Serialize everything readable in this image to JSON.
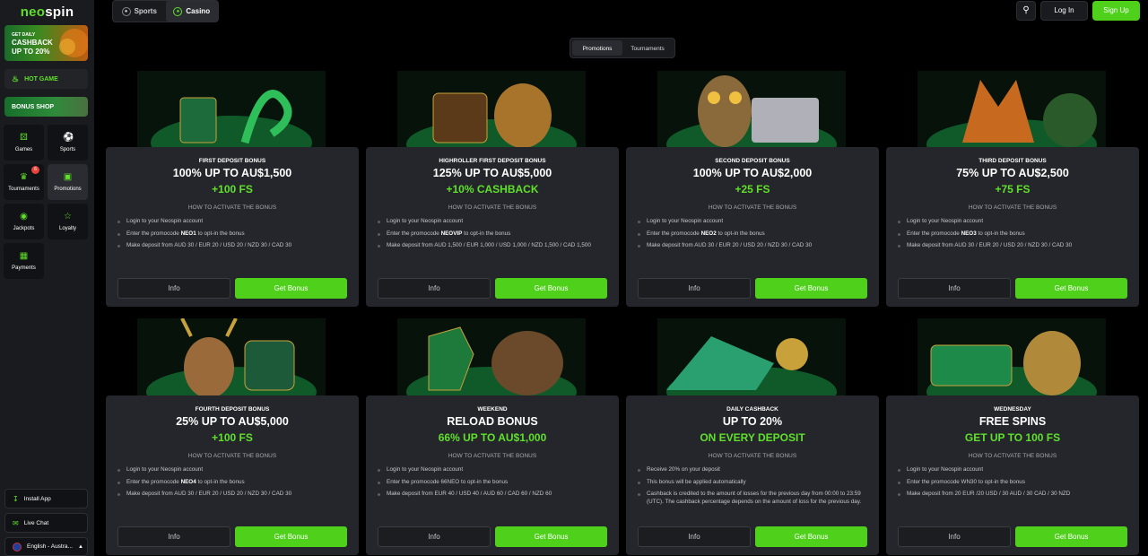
{
  "brand": {
    "part1": "neo",
    "part2": "spin"
  },
  "sidebar": {
    "banner": {
      "l1": "GET DAILY",
      "l2": "CASHBACK",
      "l3": "UP TO 20%"
    },
    "hot_game": "HOT GAME",
    "bonus_shop": "BONUS SHOP",
    "tiles": [
      {
        "label": "Games",
        "icon": "dice-icon"
      },
      {
        "label": "Sports",
        "icon": "soccer-ball-icon"
      },
      {
        "label": "Tournaments",
        "icon": "trophy-icon",
        "badge": "6"
      },
      {
        "label": "Promotions",
        "icon": "gift-icon"
      },
      {
        "label": "Jackpots",
        "icon": "money-bag-icon"
      },
      {
        "label": "Loyalty",
        "icon": "star-icon"
      },
      {
        "label": "Payments",
        "icon": "cash-icon"
      }
    ],
    "install_app": "Install App",
    "live_chat": "Live Chat",
    "language": "English - Austra..."
  },
  "topbar": {
    "sports": "Sports",
    "casino": "Casino",
    "login": "Log In",
    "signup": "Sign Up"
  },
  "subtabs": {
    "promotions": "Promotions",
    "tournaments": "Tournaments"
  },
  "colors": {
    "accent": "#4fd01a",
    "bonus_text": "#5fe02a",
    "card": "#25262b",
    "sidebar": "#1a1b1f"
  },
  "how_label": "HOW TO ACTIVATE THE BONUS",
  "info_label": "Info",
  "get_label": "Get Bonus",
  "cards": [
    {
      "kicker": "FIRST DEPOSIT BONUS",
      "head": "100% UP TO AU$1,500",
      "bonus": "+100 FS",
      "items": [
        [
          "Login to your Neospin account",
          "",
          ""
        ],
        [
          "Enter the promocode ",
          "NEO1",
          " to opt-in the bonus"
        ],
        [
          "Make deposit from AUD 30 / EUR 20 / USD 20 / NZD 30 / CAD 30",
          "",
          ""
        ]
      ]
    },
    {
      "kicker": "HIGHROLLER FIRST DEPOSIT BONUS",
      "head": "125% UP TO AU$5,000",
      "bonus": "+10% CASHBACK",
      "items": [
        [
          "Login to your Neospin account",
          "",
          ""
        ],
        [
          "Enter the promocode ",
          "NEOVIP",
          " to opt-in the bonus"
        ],
        [
          "Make deposit from AUD 1,500 / EUR 1,000 / USD 1,000 / NZD 1,500 / CAD 1,500",
          "",
          ""
        ]
      ]
    },
    {
      "kicker": "SECOND DEPOSIT BONUS",
      "head": "100% UP TO AU$2,000",
      "bonus": "+25 FS",
      "items": [
        [
          "Login to your Neospin account",
          "",
          ""
        ],
        [
          "Enter the promocode ",
          "NEO2",
          " to opt-in the bonus"
        ],
        [
          "Make deposit from AUD 30 / EUR 20 / USD 20 / NZD 30 / CAD 30",
          "",
          ""
        ]
      ]
    },
    {
      "kicker": "THIRD DEPOSIT BONUS",
      "head": "75% UP TO AU$2,500",
      "bonus": "+75 FS",
      "items": [
        [
          "Login to your Neospin account",
          "",
          ""
        ],
        [
          "Enter the promocode ",
          "NEO3",
          " to opt-in the bonus"
        ],
        [
          "Make deposit from AUD 30 / EUR 20 / USD 20 / NZD 30 / CAD 30",
          "",
          ""
        ]
      ]
    },
    {
      "kicker": "FOURTH DEPOSIT BONUS",
      "head": "25% UP TO AU$5,000",
      "bonus": "+100 FS",
      "items": [
        [
          "Login to your Neospin account",
          "",
          ""
        ],
        [
          "Enter the promocode ",
          "NEO4",
          " to opt-in the bonus"
        ],
        [
          "Make deposit from AUD 30 / EUR 20 / USD 20 / NZD 30 / CAD 30",
          "",
          ""
        ]
      ]
    },
    {
      "kicker": "WEEKEND",
      "head": "RELOAD BONUS",
      "bonus": "66% UP TO AU$1,000",
      "items": [
        [
          "Login to your Neospin account",
          "",
          ""
        ],
        [
          "Enter the promocode 66NEO to opt-in the bonus",
          "",
          ""
        ],
        [
          "Make deposit from EUR 40 / USD 40 / AUD 60 / CAD 60 / NZD 60",
          "",
          ""
        ]
      ]
    },
    {
      "kicker": "DAILY CASHBACK",
      "head": "UP TO 20%",
      "bonus": "ON EVERY DEPOSIT",
      "items": [
        [
          "Receive 20% on your deposit",
          "",
          ""
        ],
        [
          "This bonus will be applied automatically",
          "",
          ""
        ],
        [
          "Cashback is credited to the amount of losses for the previous day from 00:00 to 23:59 (UTC). The cashback percentage depends on the amount of loss for the previous day.",
          "",
          ""
        ]
      ]
    },
    {
      "kicker": "WEDNESDAY",
      "head": "FREE SPINS",
      "bonus": "GET UP TO 100 FS",
      "items": [
        [
          "Login to your Neospin account",
          "",
          ""
        ],
        [
          "Enter the promocode WN30 to opt-in the bonus",
          "",
          ""
        ],
        [
          "Make deposit from 20 EUR /20 USD / 30 AUD / 30 CAD / 30 NZD",
          "",
          ""
        ]
      ]
    }
  ]
}
